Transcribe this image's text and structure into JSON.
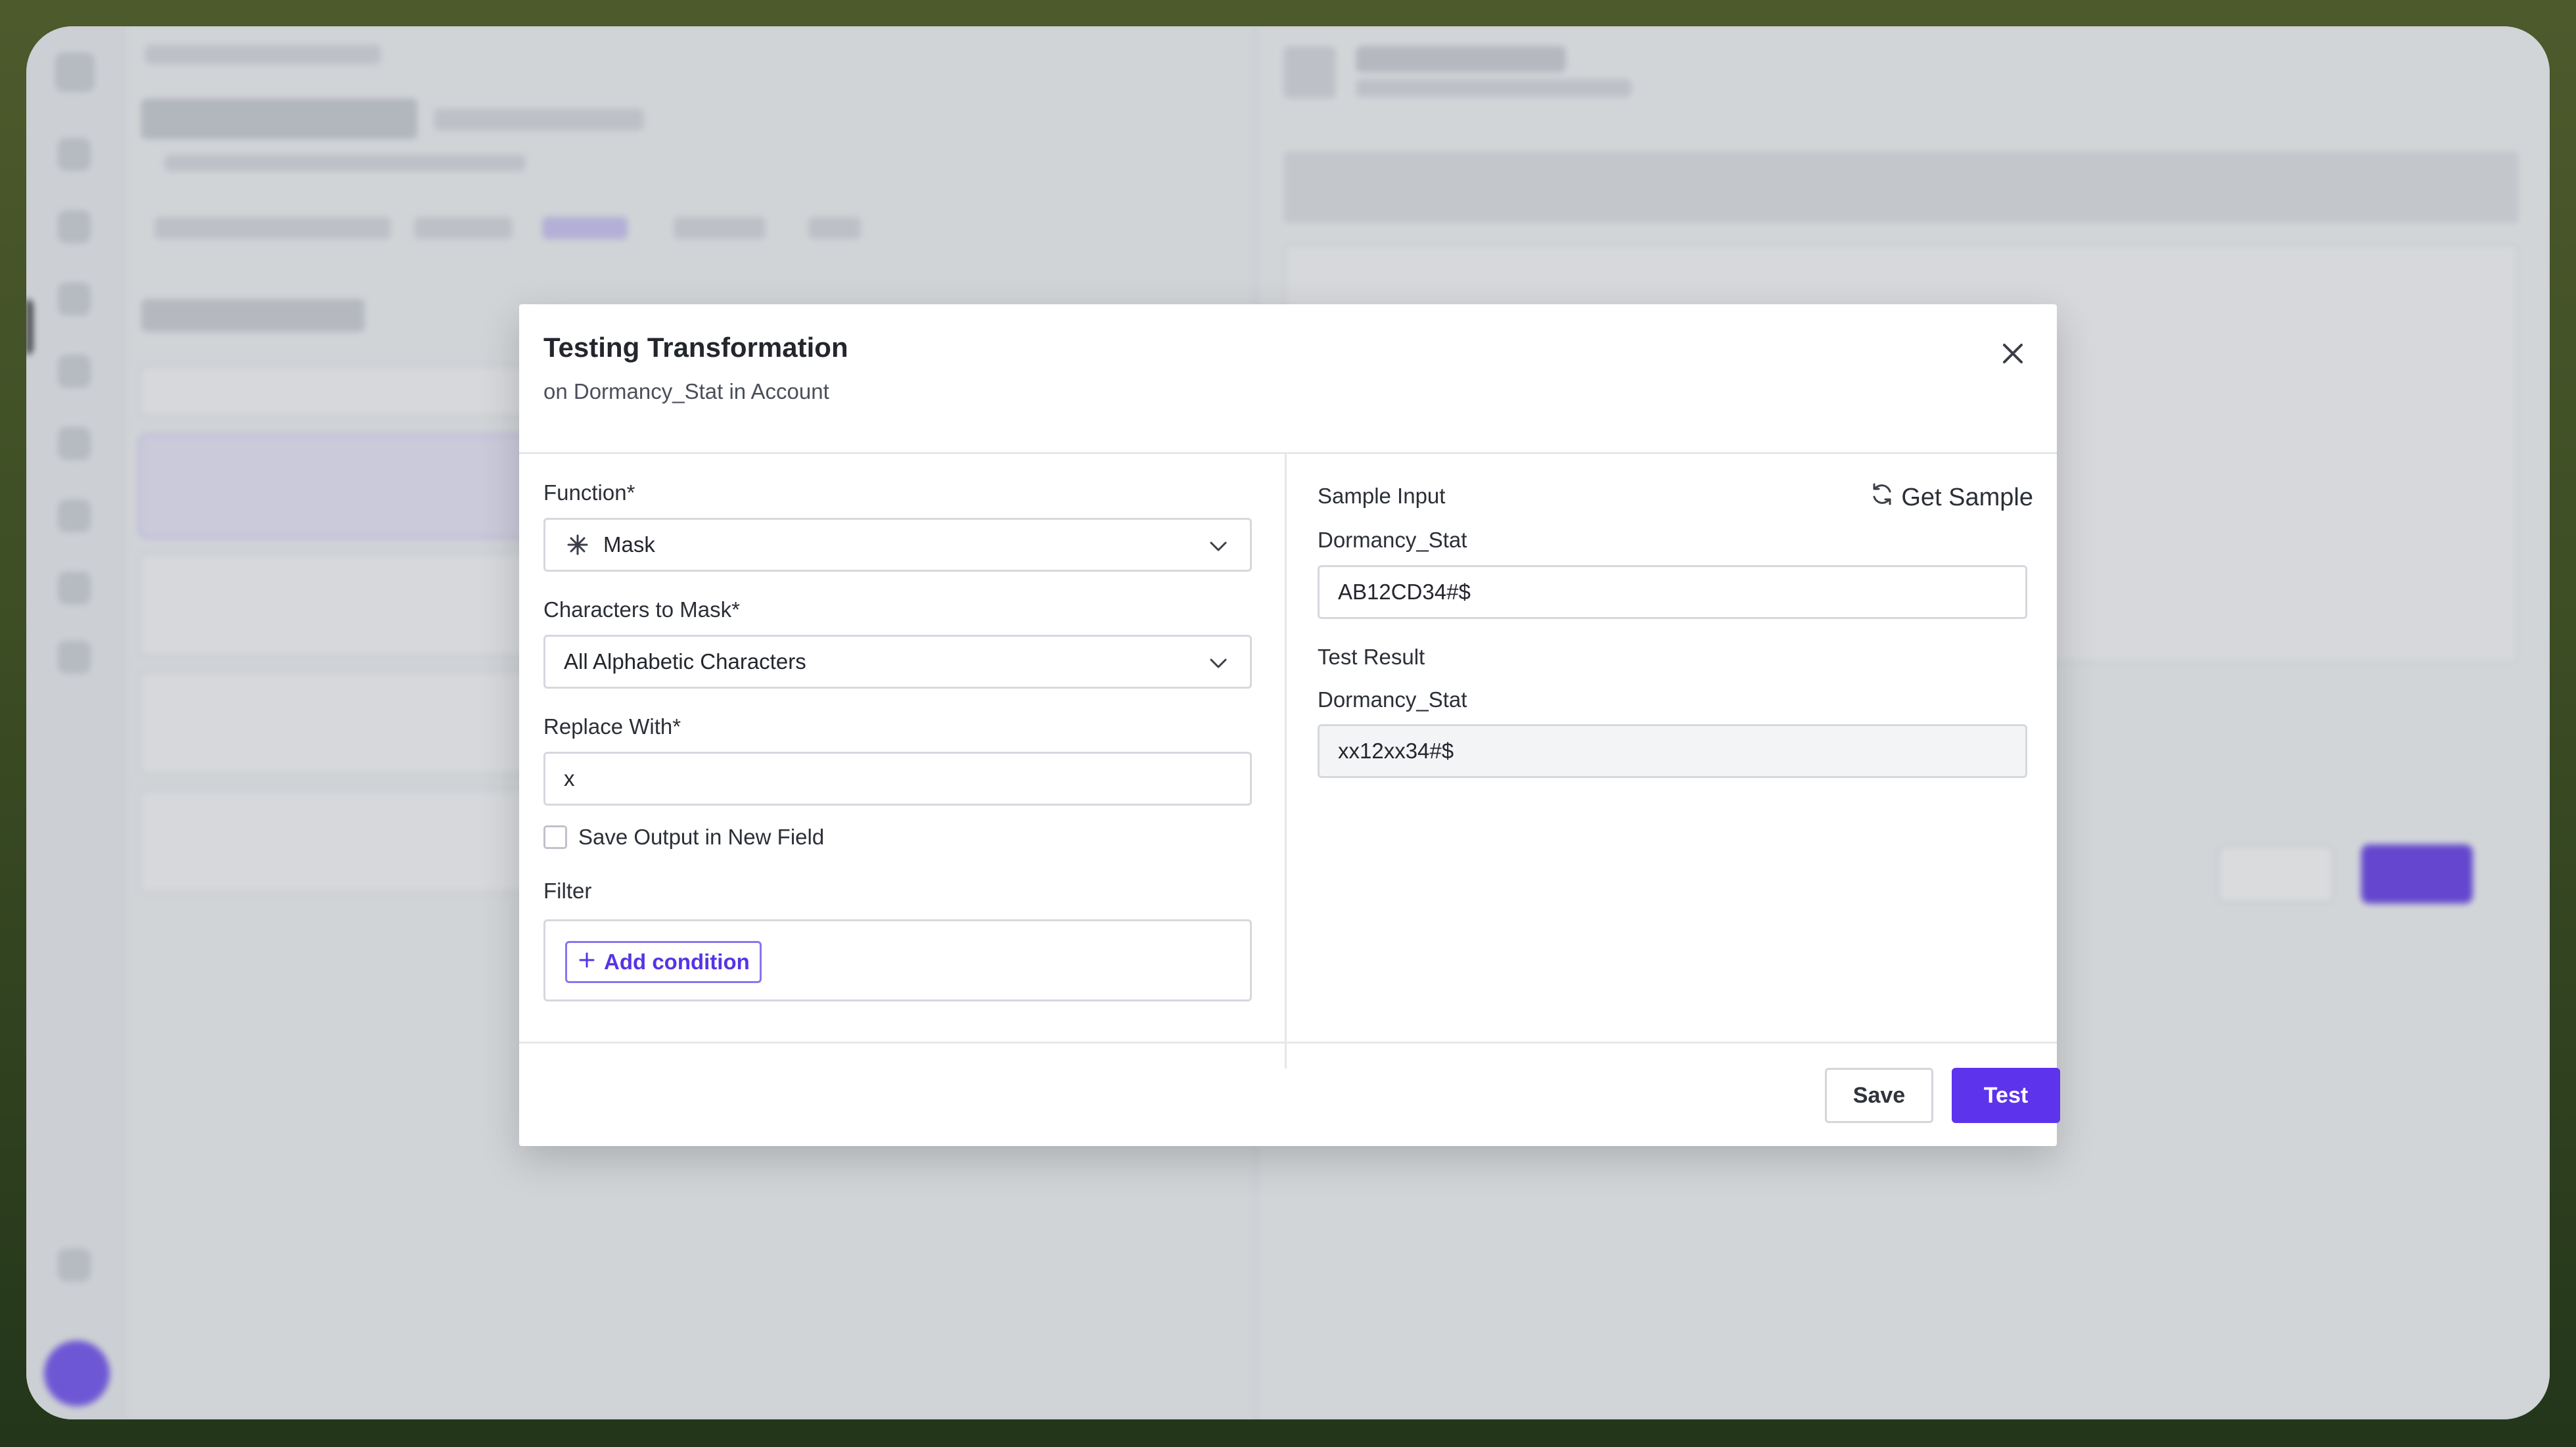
{
  "modal": {
    "title": "Testing Transformation",
    "subtitle": "on Dormancy_Stat in Account",
    "close_icon": "close-icon"
  },
  "left": {
    "function_label": "Function*",
    "function_value": "Mask",
    "function_icon": "asterisk-icon",
    "chars_label": "Characters to Mask*",
    "chars_value": "All Alphabetic Characters",
    "replace_label": "Replace With*",
    "replace_value": "x",
    "save_output_label": "Save Output in New Field",
    "save_output_checked": false,
    "filter_label": "Filter",
    "add_condition_label": "Add condition"
  },
  "right": {
    "sample_input_label": "Sample Input",
    "get_sample_label": "Get Sample",
    "sample_field_label": "Dormancy_Stat",
    "sample_value": "AB12CD34#$",
    "test_result_label": "Test Result",
    "result_field_label": "Dormancy_Stat",
    "result_value": "xx12xx34#$"
  },
  "footer": {
    "save_label": "Save",
    "test_label": "Test"
  },
  "colors": {
    "accent": "#5d33eb",
    "accent_text": "#5634e6"
  }
}
